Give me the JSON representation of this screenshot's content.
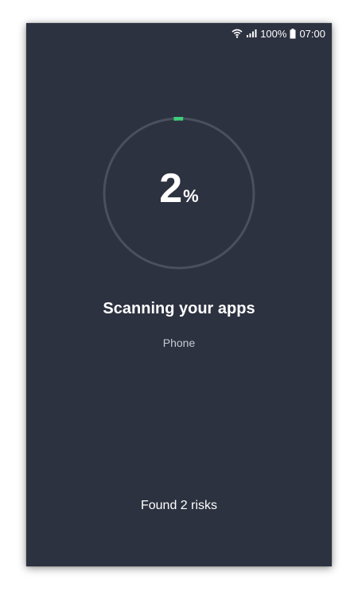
{
  "status_bar": {
    "wifi_icon": "wifi-icon",
    "signal_icon": "cell-signal-icon",
    "battery_text": "100%",
    "battery_icon": "battery-icon",
    "time": "07:00"
  },
  "scan": {
    "progress_percent": 2,
    "percent_value": "2",
    "percent_sign": "%",
    "title": "Scanning your apps",
    "current_item": "Phone",
    "risks_text": "Found 2 risks"
  },
  "colors": {
    "background": "#2c3240",
    "ring_track": "#4a505d",
    "ring_progress": "#3ecf7a",
    "text_primary": "#ffffff",
    "text_secondary": "#c7cad2"
  }
}
